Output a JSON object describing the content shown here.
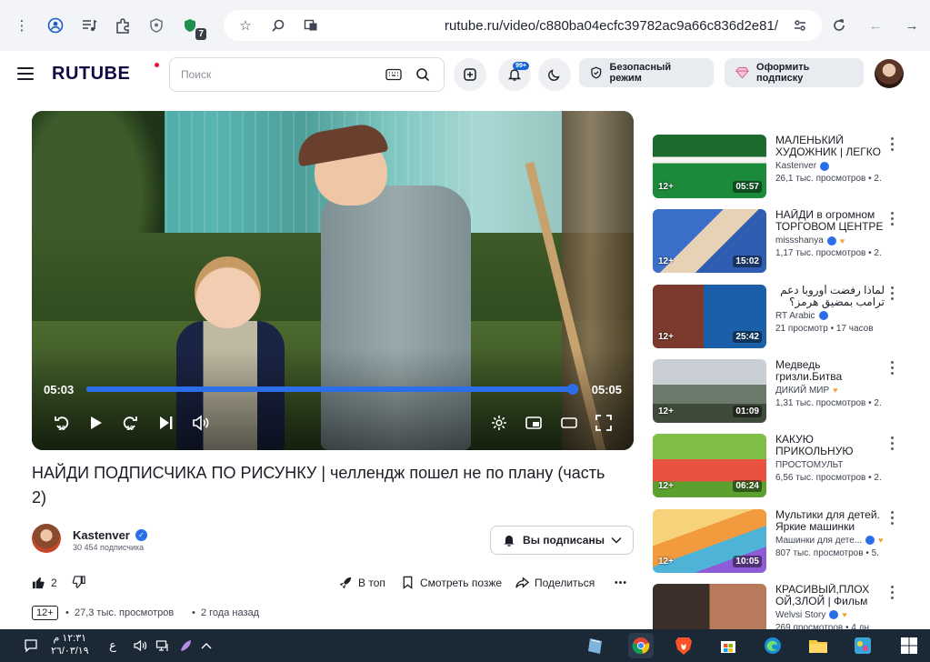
{
  "browser": {
    "url": "rutube.ru/video/c880ba04ecfc39782ac9a66c836d2e81/",
    "ext_badge": "7"
  },
  "header": {
    "logo": "RUTUBE",
    "search_placeholder": "Поиск",
    "notif_badge": "99+",
    "safe_mode": "Безопасный режим",
    "subscribe_offer": "Оформить подписку"
  },
  "player": {
    "current_time": "05:03",
    "duration": "05:05",
    "progress": 0.99,
    "rewind_label": "10",
    "forward_label": "10"
  },
  "video": {
    "title": "НАЙДИ ПОДПИСЧИКА ПО РИСУНКУ | челлендж пошел не по плану (часть 2)",
    "channel": "Kastenver",
    "subscribers": "30 454 подписчика",
    "subscribe_state": "Вы подписаны",
    "likes": "2",
    "to_top": "В топ",
    "watch_later": "Смотреть позже",
    "share": "Поделиться",
    "age": "12+",
    "views": "27,3 тыс. просмотров",
    "date": "2 года назад"
  },
  "recommendations": [
    {
      "title": "МАЛЕНЬКИЙ ХУДОЖНИК | ЛЕГКО ЛИ",
      "channel": "Kastenver",
      "verified": true,
      "heart": false,
      "meta": "26,1 тыс. просмотров  •  2.",
      "age": "12+",
      "duration": "05:57",
      "thumb": "thumb1"
    },
    {
      "title": "НАЙДИ в огромном ТОРГОВОМ ЦЕНТРЕ",
      "channel": "missshanya",
      "verified": true,
      "heart": true,
      "meta": "1,17 тыс. просмотров  •  2.",
      "age": "12+",
      "duration": "15:02",
      "thumb": "thumb2"
    },
    {
      "title": "لماذا رفضت أوروبا دعم ترامب بمضيق هرمز؟",
      "channel": "RT Arabic",
      "verified": true,
      "heart": false,
      "meta": "21 просмотр  •  17 часов",
      "age": "12+",
      "duration": "25:42",
      "thumb": "thumb3"
    },
    {
      "title": "Медведь гризли.Битва медведей",
      "channel": "ДИКИЙ МИР",
      "verified": false,
      "heart": true,
      "meta": "1,31 тыс. просмотров  •  2.",
      "age": "12+",
      "duration": "01:09",
      "thumb": "thumb4"
    },
    {
      "title": "КАКУЮ ПРИКОЛЬНУЮ ДОРОГУ",
      "channel": "ПРОСТОМУЛЬТ",
      "verified": false,
      "heart": false,
      "meta": "6,56 тыс. просмотров  •  2.",
      "age": "12+",
      "duration": "06:24",
      "thumb": "thumb5"
    },
    {
      "title": "Мультики для детей. Яркие машинки",
      "channel": "Машинки для дете...",
      "verified": true,
      "heart": true,
      "meta": "807 тыс. просмотров  •  5.",
      "age": "12+",
      "duration": "10:05",
      "thumb": "thumb6"
    },
    {
      "title": "КРАСИВЫЙ,ПЛОХ ОЙ,ЗЛОЙ | Фильм",
      "channel": "Welvsi Story",
      "verified": true,
      "heart": true,
      "meta": "269 просмотров  •  4 дн",
      "age": "",
      "duration": "",
      "thumb": "thumb7"
    }
  ],
  "taskbar": {
    "time": "١٢:٣١ م",
    "date": "٢٦/٠٣/١٩",
    "lang": "ع"
  }
}
